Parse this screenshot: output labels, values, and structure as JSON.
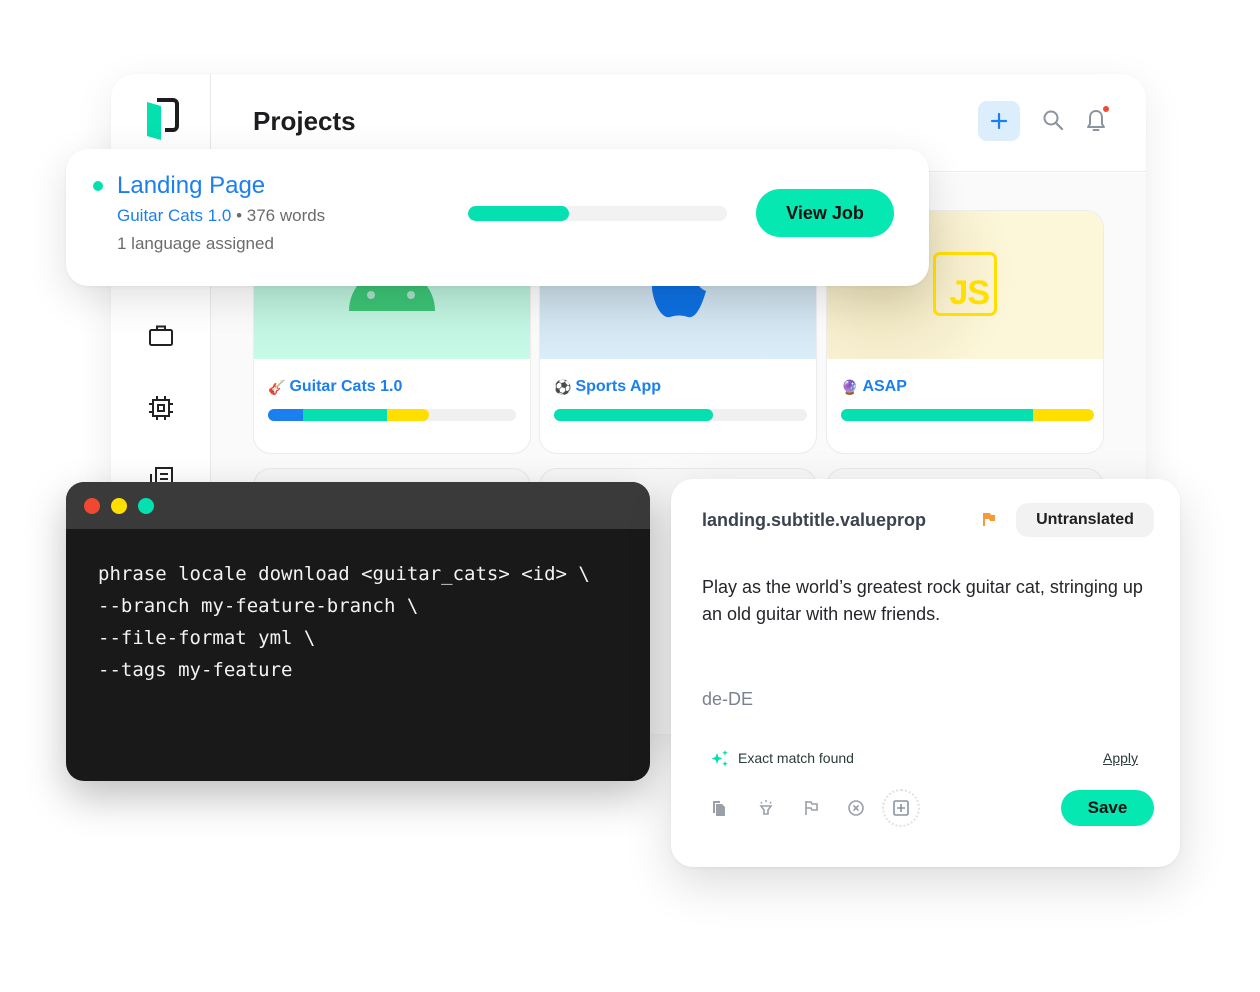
{
  "app": {
    "page_title": "Projects",
    "header_icons": [
      "plus-icon",
      "search-icon",
      "bell-icon"
    ],
    "sidebar_icons": [
      "briefcase-icon",
      "chip-icon",
      "document-list-icon"
    ],
    "brand_color": "#05e8b2",
    "link_color": "#1b7ff0"
  },
  "job_card": {
    "title": "Landing Page",
    "project": "Guitar Cats 1.0",
    "separator": "•",
    "word_count": "376 words",
    "languages": "1 language assigned",
    "progress_percent": 39,
    "button_label": "View Job"
  },
  "projects": [
    {
      "name": "Guitar Cats 1.0",
      "emoji": "🎸",
      "platform": "android",
      "progress_segments": [
        {
          "color": "#1b7ff0",
          "percent": 14
        },
        {
          "color": "#05e0b0",
          "percent": 34
        },
        {
          "color": "#ffde00",
          "percent": 17
        }
      ]
    },
    {
      "name": "Sports App",
      "emoji": "⚽",
      "platform": "apple",
      "progress_segments": [
        {
          "color": "#05e0b0",
          "percent": 63
        }
      ]
    },
    {
      "name": "ASAP",
      "emoji": "🔮",
      "platform": "javascript",
      "logo_text": "JS",
      "progress_segments": [
        {
          "color": "#05e0b0",
          "percent": 76
        },
        {
          "color": "#ffde00",
          "percent": 24
        }
      ]
    }
  ],
  "terminal": {
    "lines": [
      "phrase locale download <guitar_cats> <id> \\",
      "--branch my-feature-branch \\",
      "--file-format yml \\",
      "--tags my-feature"
    ]
  },
  "translation": {
    "key": "landing.subtitle.valueprop",
    "status": "Untranslated",
    "source_text": "Play as the world’s greatest rock guitar cat, stringing up an old guitar with new friends.",
    "locale": "de-DE",
    "match_text": "Exact match found",
    "apply_label": "Apply",
    "save_label": "Save",
    "toolbar_icons": [
      "copy-icon",
      "lightbulb-icon",
      "flag-icon",
      "close-circle-icon",
      "add-square-icon"
    ]
  }
}
